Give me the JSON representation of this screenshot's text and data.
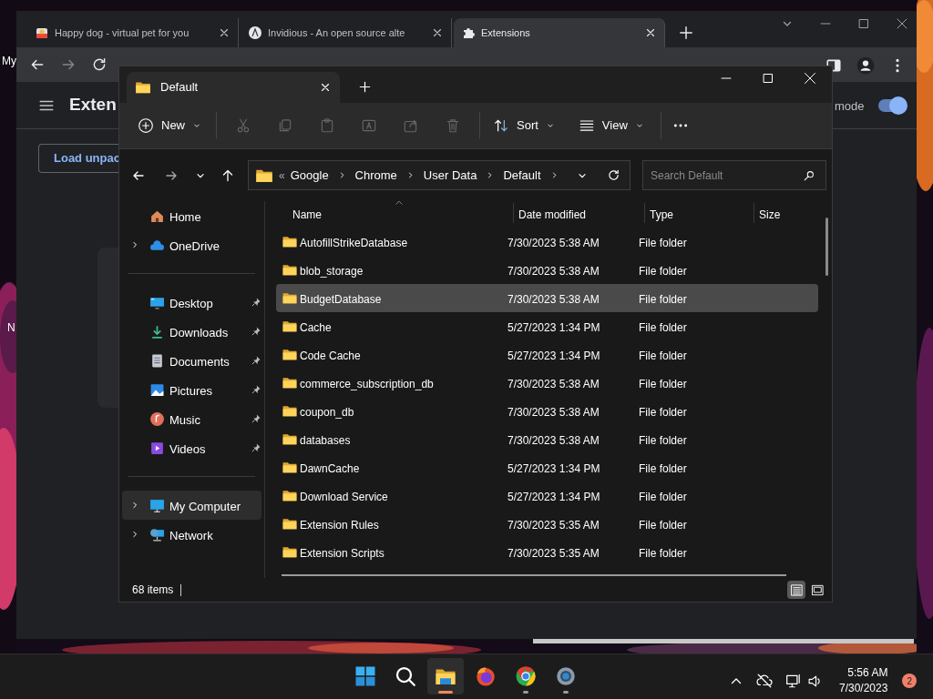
{
  "desktop": {
    "icon_labels": [
      "My",
      "N"
    ]
  },
  "browser": {
    "tabs": [
      {
        "title": "Happy dog - virtual pet for you",
        "kind": "pet",
        "selected": false
      },
      {
        "title": "Invidious - An open source alte",
        "kind": "invidious",
        "selected": false
      },
      {
        "title": "Extensions",
        "kind": "puzzle",
        "selected": true
      }
    ],
    "page": {
      "title": "Exten",
      "mode_label": "mode",
      "developer_mode_on": true,
      "load_button": "Load unpac"
    }
  },
  "explorer": {
    "tab_title": "Default",
    "toolbar": {
      "new": "New",
      "sort": "Sort",
      "view": "View",
      "actions": [
        {
          "kind": "cut",
          "disabled": true
        },
        {
          "kind": "copy",
          "disabled": true
        },
        {
          "kind": "paste",
          "disabled": true
        },
        {
          "kind": "rename",
          "disabled": true
        },
        {
          "kind": "share",
          "disabled": true
        },
        {
          "kind": "delete",
          "disabled": true
        }
      ]
    },
    "overflow_mark": "«",
    "breadcrumb": [
      "Google",
      "Chrome",
      "User Data",
      "Default"
    ],
    "search_placeholder": "Search Default",
    "sidebar": [
      [
        {
          "label": "Home",
          "kind": "home",
          "expandable": false,
          "pinned": false,
          "selected": false
        },
        {
          "label": "OneDrive",
          "kind": "cloud",
          "expandable": true,
          "pinned": false,
          "selected": false
        }
      ],
      [
        {
          "label": "Desktop",
          "kind": "desktop",
          "expandable": false,
          "pinned": true,
          "selected": false
        },
        {
          "label": "Downloads",
          "kind": "download",
          "expandable": false,
          "pinned": true,
          "selected": false
        },
        {
          "label": "Documents",
          "kind": "document",
          "expandable": false,
          "pinned": true,
          "selected": false
        },
        {
          "label": "Pictures",
          "kind": "pictures",
          "expandable": false,
          "pinned": true,
          "selected": false
        },
        {
          "label": "Music",
          "kind": "music",
          "expandable": false,
          "pinned": true,
          "selected": false
        },
        {
          "label": "Videos",
          "kind": "video",
          "expandable": false,
          "pinned": true,
          "selected": false
        }
      ],
      [
        {
          "label": "My Computer",
          "kind": "monitor",
          "expandable": true,
          "pinned": false,
          "selected": true
        },
        {
          "label": "Network",
          "kind": "network",
          "expandable": true,
          "pinned": false,
          "selected": false
        }
      ]
    ],
    "columns": [
      "Name",
      "Date modified",
      "Type",
      "Size"
    ],
    "rows": [
      {
        "name": "AutofillStrikeDatabase",
        "date": "7/30/2023 5:38 AM",
        "type": "File folder",
        "selected": false
      },
      {
        "name": "blob_storage",
        "date": "7/30/2023 5:38 AM",
        "type": "File folder",
        "selected": false
      },
      {
        "name": "BudgetDatabase",
        "date": "7/30/2023 5:38 AM",
        "type": "File folder",
        "selected": true
      },
      {
        "name": "Cache",
        "date": "5/27/2023 1:34 PM",
        "type": "File folder",
        "selected": false
      },
      {
        "name": "Code Cache",
        "date": "5/27/2023 1:34 PM",
        "type": "File folder",
        "selected": false
      },
      {
        "name": "commerce_subscription_db",
        "date": "7/30/2023 5:38 AM",
        "type": "File folder",
        "selected": false
      },
      {
        "name": "coupon_db",
        "date": "7/30/2023 5:38 AM",
        "type": "File folder",
        "selected": false
      },
      {
        "name": "databases",
        "date": "7/30/2023 5:38 AM",
        "type": "File folder",
        "selected": false
      },
      {
        "name": "DawnCache",
        "date": "5/27/2023 1:34 PM",
        "type": "File folder",
        "selected": false
      },
      {
        "name": "Download Service",
        "date": "5/27/2023 1:34 PM",
        "type": "File folder",
        "selected": false
      },
      {
        "name": "Extension Rules",
        "date": "7/30/2023 5:35 AM",
        "type": "File folder",
        "selected": false
      },
      {
        "name": "Extension Scripts",
        "date": "7/30/2023 5:35 AM",
        "type": "File folder",
        "selected": false
      }
    ],
    "status": "68 items",
    "view_modes": [
      {
        "kind": "details",
        "selected": true
      },
      {
        "kind": "tiles",
        "selected": false
      }
    ]
  },
  "taskbar": {
    "apps": [
      {
        "kind": "start",
        "running": false,
        "selected": false
      },
      {
        "kind": "search",
        "running": false,
        "selected": false
      },
      {
        "kind": "explorer",
        "running": true,
        "selected": true
      },
      {
        "kind": "firefox",
        "running": false,
        "selected": false
      },
      {
        "kind": "chrome",
        "running": true,
        "selected": false
      },
      {
        "kind": "settings",
        "running": true,
        "selected": false
      }
    ],
    "time": "5:56 AM",
    "date": "7/30/2023",
    "notifications": "2"
  }
}
